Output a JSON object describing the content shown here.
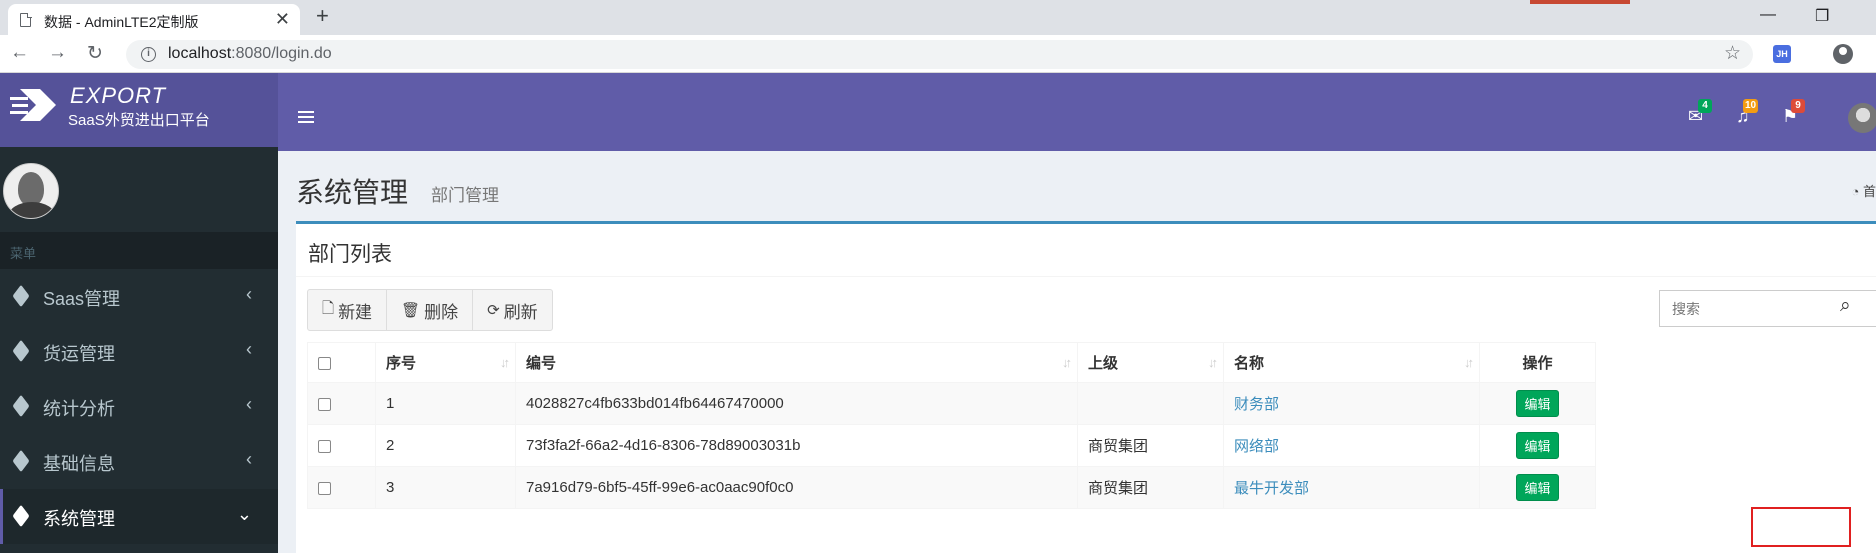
{
  "browser": {
    "tab_title": "数据 - AdminLTE2定制版",
    "tab_close": "✕",
    "new_tab": "+",
    "window_minimize": "—",
    "window_restore": "❐",
    "url_host": "localhost",
    "url_rest": ":8080/login.do",
    "extension_label": "JH"
  },
  "header": {
    "brand": "EXPORT",
    "subtitle": "SaaS外贸进出口平台",
    "mail_count": "4",
    "bell_count": "10",
    "flag_count": "9",
    "badge_colors": {
      "mail": "#00a65a",
      "bell": "#f39c12",
      "flag": "#dd4b39"
    }
  },
  "sidebar": {
    "menu_header": "菜单",
    "items": [
      {
        "label": "Saas管理",
        "chevron": "‹"
      },
      {
        "label": "货运管理",
        "chevron": "‹"
      },
      {
        "label": "统计分析",
        "chevron": "‹"
      },
      {
        "label": "基础信息",
        "chevron": "‹"
      },
      {
        "label": "系统管理",
        "chevron": "⌄"
      }
    ]
  },
  "page": {
    "title": "系统管理",
    "subtitle": "部门管理",
    "breadcrumb": "首"
  },
  "box": {
    "title": "部门列表",
    "buttons": {
      "new": "新建",
      "delete": "删除",
      "refresh": "刷新"
    },
    "search_placeholder": "搜索"
  },
  "table": {
    "headers": [
      "序号",
      "编号",
      "上级",
      "名称",
      "操作"
    ],
    "sort_glyph": "↓↑",
    "edit_label": "编辑",
    "rows": [
      {
        "no": "1",
        "id": "4028827c4fb633bd014fb64467470000",
        "parent": "",
        "name": "财务部"
      },
      {
        "no": "2",
        "id": "73f3fa2f-66a2-4d16-8306-78d89003031b",
        "parent": "商贸集团",
        "name": "网络部"
      },
      {
        "no": "3",
        "id": "7a916d79-6bf5-45ff-99e6-ac0aac90f0c0",
        "parent": "商贸集团",
        "name": "最牛开发部"
      }
    ]
  }
}
